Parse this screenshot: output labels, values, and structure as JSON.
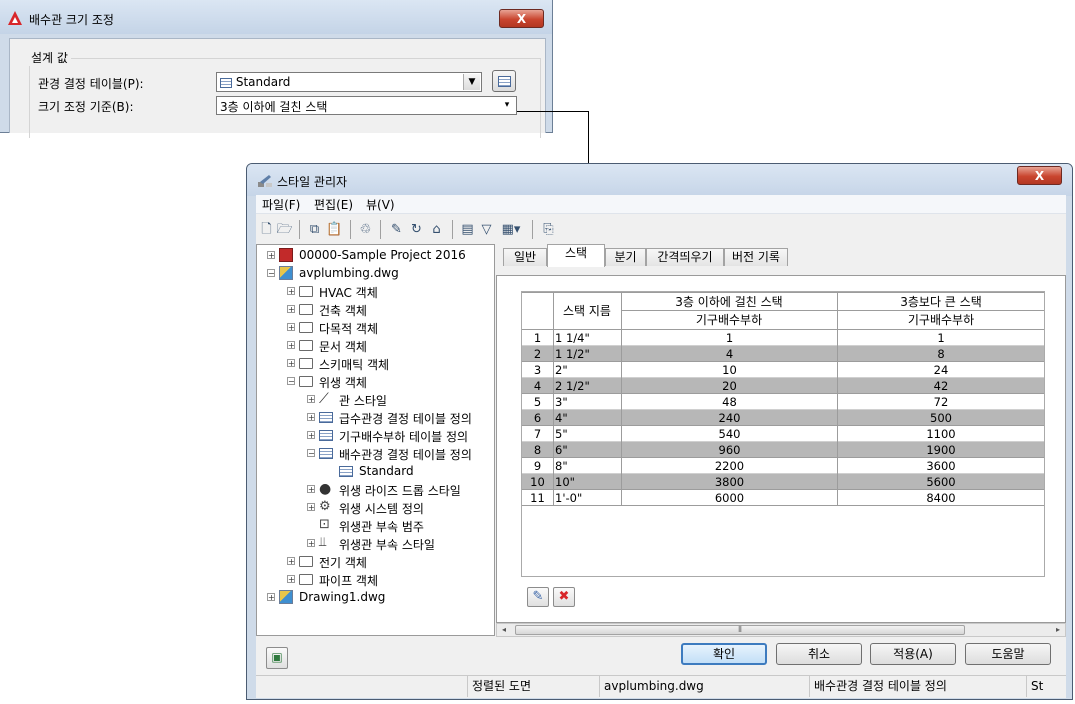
{
  "pipe_size_dialog": {
    "title": "배수관 크기 조정",
    "close_label": "X",
    "group_label": "설계 값",
    "table_label": "관경 결정 테이블(P):",
    "table_value": "Standard",
    "basis_label": "크기 조정 기준(B):",
    "basis_value": "3층 이하에 걸친 스택"
  },
  "style_manager": {
    "title": "스타일 관리자",
    "close_label": "X",
    "menu": [
      "파일(F)",
      "편집(E)",
      "뷰(V)"
    ],
    "tree": [
      {
        "label": "00000-Sample Project 2016",
        "icon": "project-icon",
        "expander": "+"
      },
      {
        "label": "avplumbing.dwg",
        "icon": "drawing-icon",
        "expander": "-"
      },
      {
        "label": "HVAC 객체",
        "icon": "folder-icon",
        "expander": "+"
      },
      {
        "label": "건축 객체",
        "icon": "folder-icon",
        "expander": "+"
      },
      {
        "label": "다목적 객체",
        "icon": "folder-icon",
        "expander": "+"
      },
      {
        "label": "문서 객체",
        "icon": "folder-icon",
        "expander": "+"
      },
      {
        "label": "스키매틱 객체",
        "icon": "folder-icon",
        "expander": "+"
      },
      {
        "label": "위생 객체",
        "icon": "folder-icon",
        "expander": "-"
      },
      {
        "label": "관 스타일",
        "icon": "pipe-style-icon",
        "expander": "+"
      },
      {
        "label": "급수관경 결정 테이블 정의",
        "icon": "table-icon",
        "expander": "+"
      },
      {
        "label": "기구배수부하 테이블 정의",
        "icon": "table-icon",
        "expander": "+"
      },
      {
        "label": "배수관경 결정 테이블 정의",
        "icon": "table-icon",
        "expander": "-"
      },
      {
        "label": "Standard",
        "icon": "table-icon",
        "expander": ""
      },
      {
        "label": "위생 라이즈 드롭 스타일",
        "icon": "rise-drop-icon",
        "expander": "+"
      },
      {
        "label": "위생 시스템 정의",
        "icon": "system-icon",
        "expander": "+"
      },
      {
        "label": "위생관 부속 범주",
        "icon": "category-icon",
        "expander": ""
      },
      {
        "label": "위생관 부속 스타일",
        "icon": "fitting-icon",
        "expander": "+"
      },
      {
        "label": "전기 객체",
        "icon": "folder-icon",
        "expander": "+"
      },
      {
        "label": "파이프 객체",
        "icon": "folder-icon",
        "expander": "+"
      },
      {
        "label": "Drawing1.dwg",
        "icon": "drawing-icon",
        "expander": "+"
      }
    ],
    "tabs": [
      "일반",
      "스택",
      "분기",
      "간격띄우기",
      "버전 기록"
    ],
    "active_tab": "스택",
    "grid": {
      "col_header_size": "스택 지름",
      "col_header_a": "3층 이하에 걸친 스택",
      "col_header_b": "3층보다 큰 스택",
      "sub_header_a": "기구배수부하",
      "sub_header_b": "기구배수부하",
      "rows": [
        {
          "n": "1",
          "size": "1 1/4\"",
          "a": "1",
          "b": "1"
        },
        {
          "n": "2",
          "size": "1 1/2\"",
          "a": "4",
          "b": "8"
        },
        {
          "n": "3",
          "size": "2\"",
          "a": "10",
          "b": "24"
        },
        {
          "n": "4",
          "size": "2 1/2\"",
          "a": "20",
          "b": "42"
        },
        {
          "n": "5",
          "size": "3\"",
          "a": "48",
          "b": "72"
        },
        {
          "n": "6",
          "size": "4\"",
          "a": "240",
          "b": "500"
        },
        {
          "n": "7",
          "size": "5\"",
          "a": "540",
          "b": "1100"
        },
        {
          "n": "8",
          "size": "6\"",
          "a": "960",
          "b": "1900"
        },
        {
          "n": "9",
          "size": "8\"",
          "a": "2200",
          "b": "3600"
        },
        {
          "n": "10",
          "size": "10\"",
          "a": "3800",
          "b": "5600"
        },
        {
          "n": "11",
          "size": "1'-0\"",
          "a": "6000",
          "b": "8400"
        }
      ]
    },
    "buttons": {
      "ok": "확인",
      "cancel": "취소",
      "apply": "적용(A)",
      "help": "도움말"
    },
    "status": [
      "정렬된 도면",
      "avplumbing.dwg",
      "배수관경 결정 테이블 정의",
      "St"
    ]
  }
}
